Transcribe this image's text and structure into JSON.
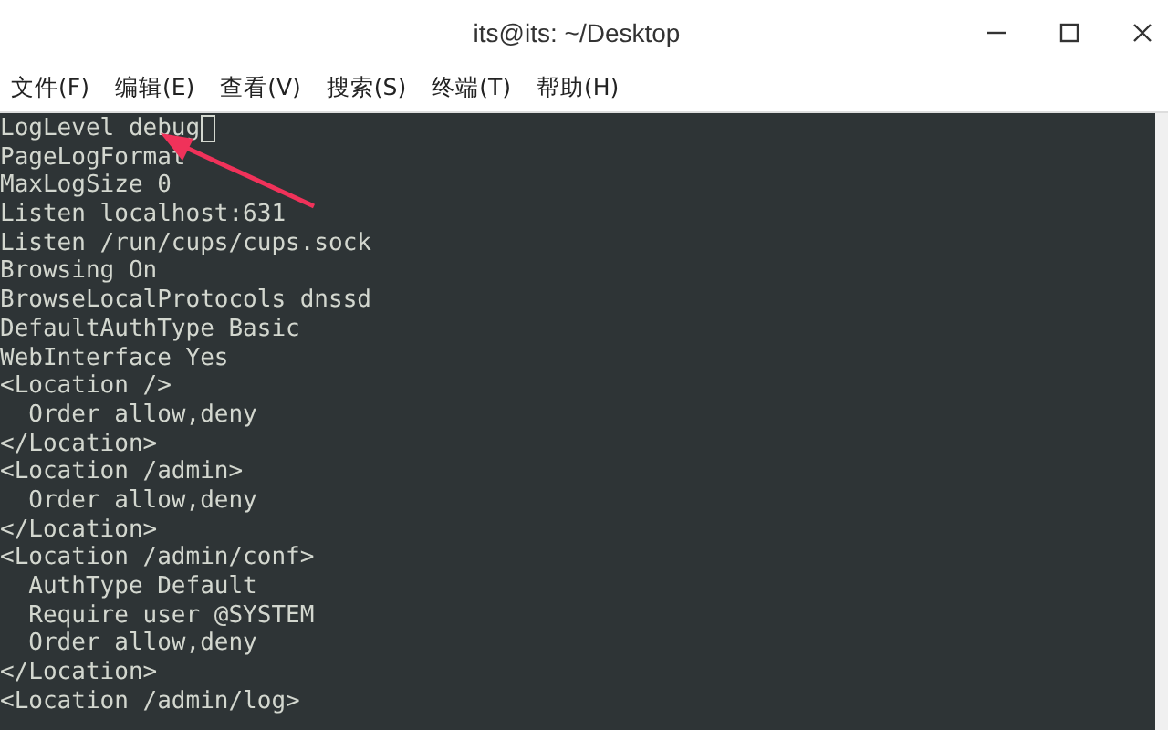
{
  "window": {
    "title": "its@its: ~/Desktop"
  },
  "menu": [
    "文件(F)",
    "编辑(E)",
    "查看(V)",
    "搜索(S)",
    "终端(T)",
    "帮助(H)"
  ],
  "terminal": {
    "lines": [
      {
        "text": "LogLevel debug",
        "cursor": true
      },
      {
        "text": "PageLogFormat",
        "cursor": false
      },
      {
        "text": "MaxLogSize 0",
        "cursor": false
      },
      {
        "text": "Listen localhost:631",
        "cursor": false
      },
      {
        "text": "Listen /run/cups/cups.sock",
        "cursor": false
      },
      {
        "text": "Browsing On",
        "cursor": false
      },
      {
        "text": "BrowseLocalProtocols dnssd",
        "cursor": false
      },
      {
        "text": "DefaultAuthType Basic",
        "cursor": false
      },
      {
        "text": "WebInterface Yes",
        "cursor": false
      },
      {
        "text": "<Location />",
        "cursor": false
      },
      {
        "text": "  Order allow,deny",
        "cursor": false
      },
      {
        "text": "</Location>",
        "cursor": false
      },
      {
        "text": "<Location /admin>",
        "cursor": false
      },
      {
        "text": "  Order allow,deny",
        "cursor": false
      },
      {
        "text": "</Location>",
        "cursor": false
      },
      {
        "text": "<Location /admin/conf>",
        "cursor": false
      },
      {
        "text": "  AuthType Default",
        "cursor": false
      },
      {
        "text": "  Require user @SYSTEM",
        "cursor": false
      },
      {
        "text": "  Order allow,deny",
        "cursor": false
      },
      {
        "text": "</Location>",
        "cursor": false
      },
      {
        "text": "<Location /admin/log>",
        "cursor": false
      }
    ]
  }
}
